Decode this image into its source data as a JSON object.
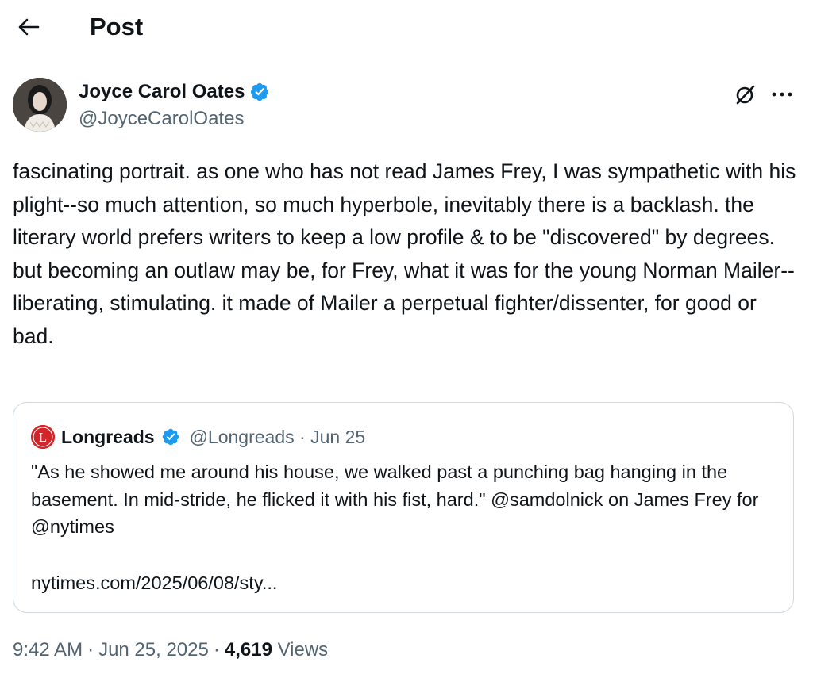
{
  "header": {
    "title": "Post"
  },
  "author": {
    "name": "Joyce Carol Oates",
    "handle": "@JoyceCarolOates"
  },
  "post": {
    "text": "fascinating portrait.  as one who has not read  James Frey, I was sympathetic with his plight--so much attention, so much hyperbole, inevitably there is a backlash.  the literary world prefers writers to keep a low profile & to be \"discovered\" by degrees.\nbut becoming an outlaw may be, for Frey, what it was for the young Norman Mailer--liberating, stimulating. it made of Mailer a perpetual fighter/dissenter, for good or bad."
  },
  "quote": {
    "avatar_letter": "L",
    "name": "Longreads",
    "handle": "@Longreads",
    "separator": "·",
    "date": "Jun 25",
    "text": "\"As he showed me around his house, we walked past a punching bag hanging in the basement. In mid-stride, he flicked it with his fist, hard.\" @samdolnick on James Frey for @nytimes",
    "link": "nytimes.com/2025/06/08/sty..."
  },
  "meta": {
    "time": "9:42 AM",
    "sep1": "·",
    "date": "Jun 25, 2025",
    "sep2": "·",
    "views_count": "4,619",
    "views_label": "Views"
  },
  "colors": {
    "text": "#0f1419",
    "secondary": "#536471",
    "verified": "#1d9bf0",
    "border": "#cfd9de",
    "longreads_red": "#d4242a"
  },
  "icons": {
    "back": "arrow-left-icon",
    "grok": "grok-icon",
    "more": "more-horizontal-icon",
    "verified": "verified-badge-icon"
  }
}
